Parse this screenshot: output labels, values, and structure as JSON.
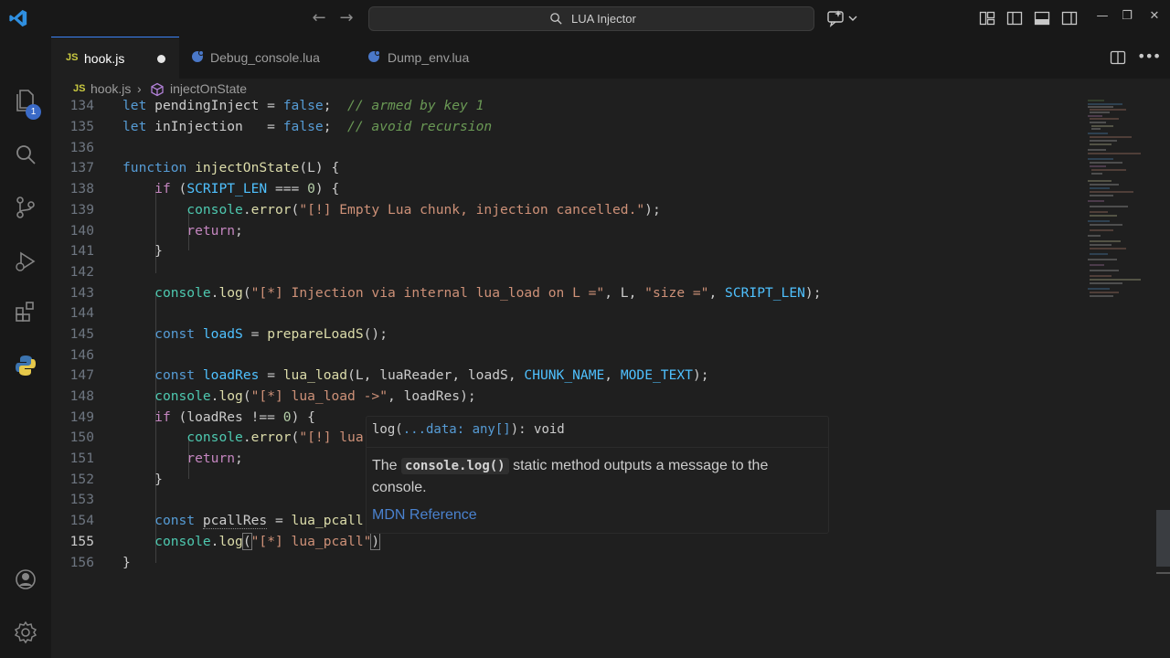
{
  "titlebar": {
    "search_text": "LUA Injector",
    "icons": [
      "vscode-logo-icon",
      "back-arrow-icon",
      "forward-arrow-icon",
      "search-icon",
      "copilot-icon",
      "customize-layout-icon",
      "toggle-primary-sidebar-icon",
      "toggle-panel-icon",
      "toggle-secondary-sidebar-icon",
      "minimize-icon",
      "restore-icon",
      "close-icon"
    ],
    "nav_back": "←",
    "nav_forward": "→",
    "minimize": "—",
    "restore": "❐",
    "close": "✕"
  },
  "activitybar": {
    "items": [
      "explorer",
      "search",
      "source-control",
      "run-and-debug",
      "extensions",
      "python"
    ],
    "explorer_badge": "1",
    "bottom": [
      "accounts",
      "manage"
    ]
  },
  "tabs": [
    {
      "label": "hook.js",
      "icon": "JS",
      "active": true,
      "dirty": true
    },
    {
      "label": "Debug_console.lua",
      "active": false
    },
    {
      "label": "Dump_env.lua",
      "active": false
    }
  ],
  "breadcrumb": {
    "file_icon": "JS",
    "file": "hook.js",
    "separator": "›",
    "symbol": "injectOnState"
  },
  "editor": {
    "current_line": 155,
    "line_numbers": [
      "134",
      "135",
      "136",
      "137",
      "138",
      "139",
      "140",
      "141",
      "142",
      "143",
      "144",
      "145",
      "146",
      "147",
      "148",
      "149",
      "150",
      "151",
      "152",
      "153",
      "154",
      "155",
      "156"
    ]
  },
  "hover": {
    "signature_name": "log(",
    "signature_param": "...data: any[]",
    "signature_rest": "): void",
    "doc_pre": "The",
    "doc_code": "console.log()",
    "doc_post": "static method outputs a message to the console.",
    "link": "MDN Reference"
  },
  "colors": {
    "accent": "#3b82f6",
    "keyword": "#569cd6",
    "function": "#dcdcaa",
    "string": "#ce9178",
    "comment": "#6a9955",
    "number": "#b5cea8"
  }
}
